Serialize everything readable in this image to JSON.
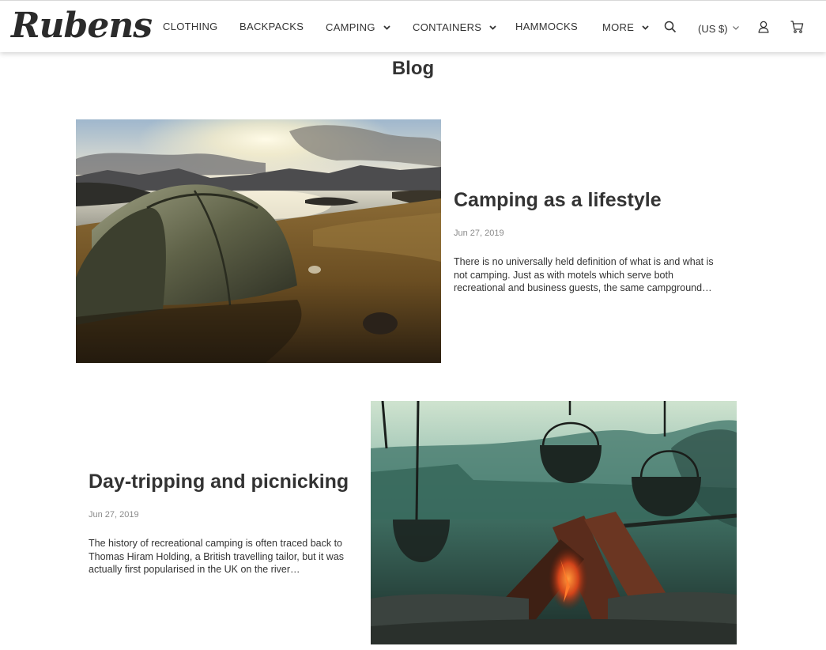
{
  "header": {
    "logo": "Rubens",
    "nav": {
      "clothing": "CLOTHING",
      "backpacks": "BACKPACKS",
      "camping": "CAMPING",
      "containers": "CONTAINERS",
      "hammocks": "HAMMOCKS",
      "more": "MORE"
    },
    "currency": "(US $)",
    "icons": [
      "search-icon",
      "user-icon",
      "cart-icon"
    ]
  },
  "page": {
    "title": "Blog"
  },
  "posts": [
    {
      "title": "Camping as a lifestyle",
      "date": "Jun 27, 2019",
      "excerpt": "There is no universally held definition of what is and what is not camping. Just as with motels which serve both recreational and business guests, the same campground…"
    },
    {
      "title": "Day-tripping and picnicking",
      "date": "Jun 27, 2019",
      "excerpt": "The history of recreational camping is often traced back to Thomas Hiram Holding, a British travelling tailor, but it was actually first popularised in the UK on the river…"
    }
  ],
  "colors": {
    "text": "#333333",
    "muted": "#8a8a8a",
    "background": "#ffffff"
  }
}
